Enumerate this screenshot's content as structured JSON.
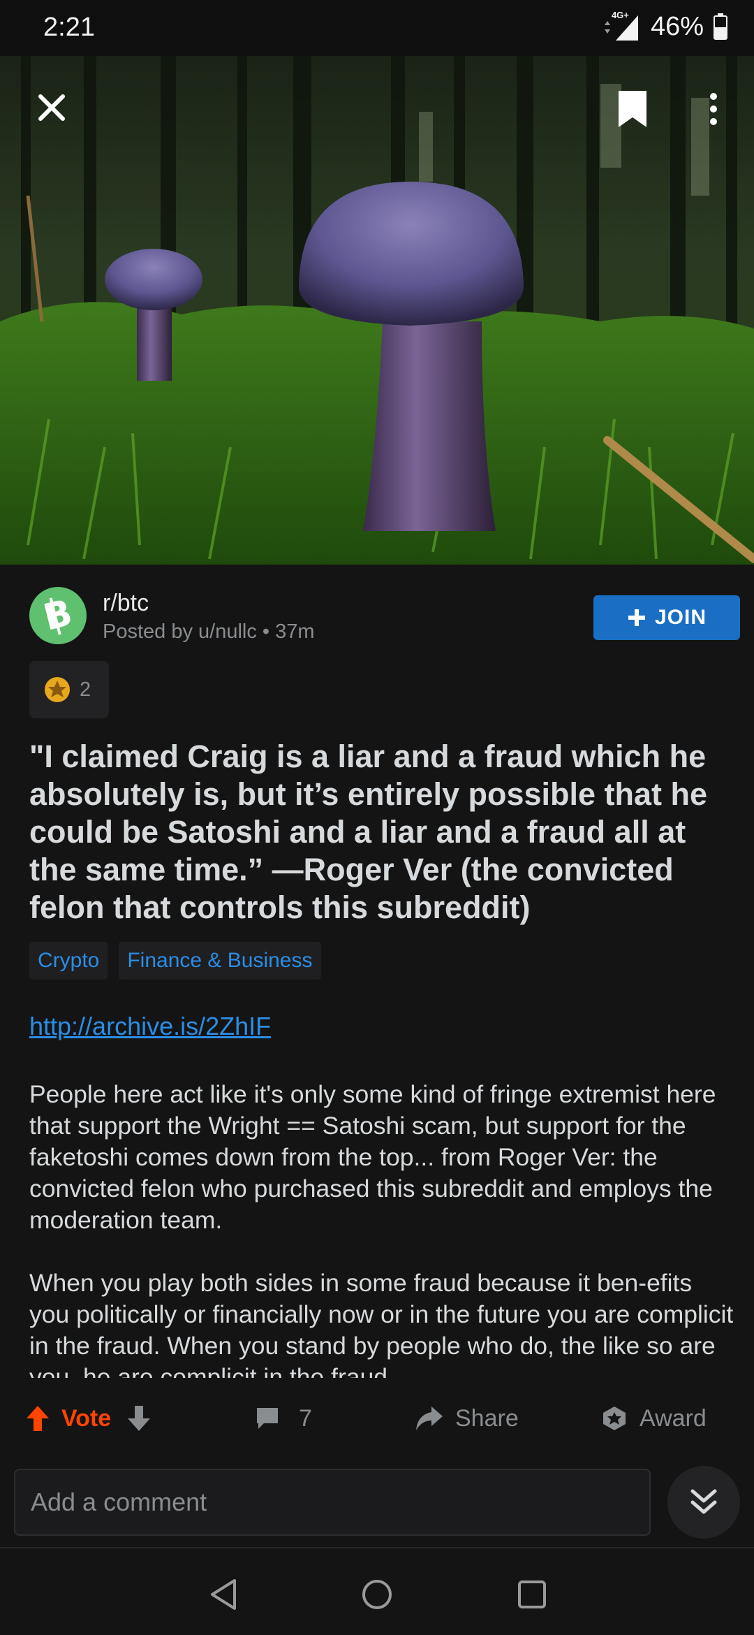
{
  "status_bar": {
    "time": "2:21",
    "network": "4G+",
    "battery": "46%"
  },
  "hero": {
    "icons": [
      "close-icon",
      "bookmark-icon",
      "more-vertical-icon"
    ]
  },
  "post": {
    "subreddit": "r/btc",
    "meta": "Posted by u/nullc • 37m",
    "join_label": "JOIN",
    "award_count": "2",
    "title": "\"I claimed Craig is a liar and a fraud which he absolutely is, but it’s entirely possible that he could be Satoshi and a liar and a fraud all at the same time.” —Roger Ver (the convicted felon that controls this subreddit)",
    "flairs": [
      "Crypto",
      "Finance & Business"
    ],
    "link": "http://archive.is/2ZhIF",
    "paragraphs": [
      "People here act like it's only some kind of fringe extremist here that support the Wright == Satoshi scam, but support for the faketoshi comes down from the top... from Roger Ver: the convicted felon who purchased this subreddit and employs the moderation team.",
      "When you play both sides in some fraud because it ben-efits you politically or financially now or in the future you are complicit in the fraud. When you stand by people who do, the like so are you, he are complicit in the fraud."
    ]
  },
  "actions": {
    "vote_label": "Vote",
    "comment_count": "7",
    "share_label": "Share",
    "award_label": "Award"
  },
  "comment_bar": {
    "placeholder": "Add a comment"
  },
  "colors": {
    "accent_blue": "#1a6fc4",
    "link_blue": "#2b8ee6",
    "upvote_orange": "#ff4500",
    "background": "#141414"
  }
}
